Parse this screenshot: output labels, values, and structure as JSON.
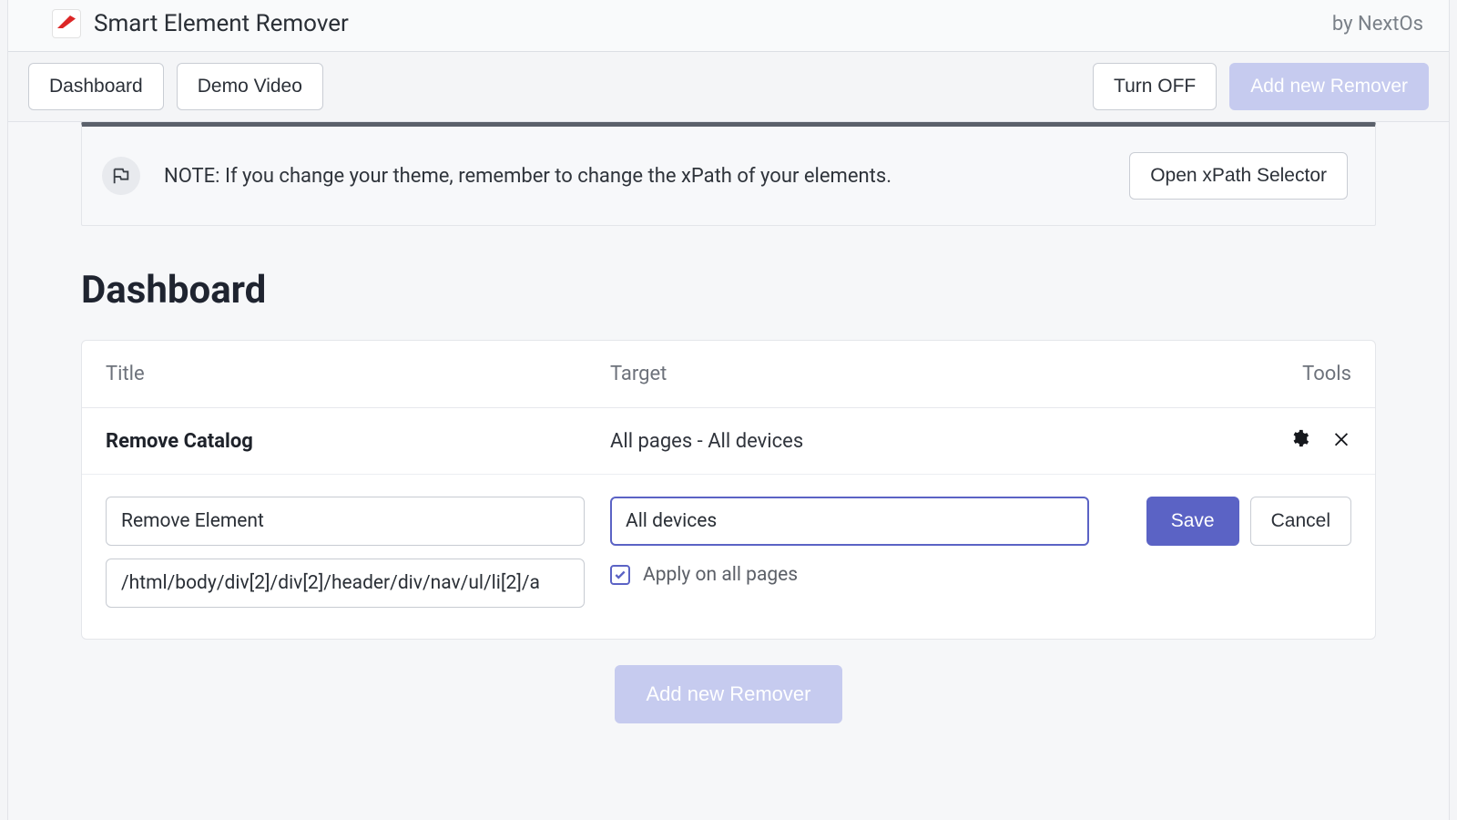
{
  "header": {
    "app_title": "Smart Element Remover",
    "by_label": "by NextOs"
  },
  "nav": {
    "dashboard_label": "Dashboard",
    "demo_video_label": "Demo Video",
    "turn_off_label": "Turn OFF",
    "add_remover_label": "Add new Remover"
  },
  "notice": {
    "text": "NOTE: If you change your theme, remember to change the xPath of your elements.",
    "open_selector_label": "Open xPath Selector"
  },
  "page": {
    "heading": "Dashboard"
  },
  "table": {
    "columns": {
      "title": "Title",
      "target": "Target",
      "tools": "Tools"
    },
    "row": {
      "title": "Remove Catalog",
      "target": "All pages - All devices"
    }
  },
  "edit": {
    "title_value": "Remove Element",
    "xpath_value": "/html/body/div[2]/div[2]/header/div/nav/ul/li[2]/a",
    "device_value": "All devices",
    "apply_all_label": "Apply on all pages",
    "apply_all_checked": true,
    "save_label": "Save",
    "cancel_label": "Cancel"
  },
  "footer": {
    "add_remover_label": "Add new Remover"
  }
}
